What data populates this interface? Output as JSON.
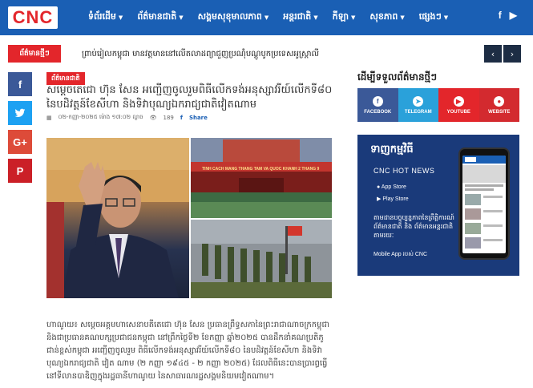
{
  "brand": {
    "logo": "CNC"
  },
  "nav": {
    "items": [
      {
        "label": "ទំព័រដើម"
      },
      {
        "label": "ព័ត៌មានជាតិ"
      },
      {
        "label": "សង្គមសុខុមាលភាព"
      },
      {
        "label": "អន្តរជាតិ"
      },
      {
        "label": "កីឡា"
      },
      {
        "label": "សុខភាព"
      },
      {
        "label": "ផ្សេងៗ"
      }
    ]
  },
  "breaking": {
    "label": "ព័ត៌មានថ្មីៗ",
    "text": "ព្រាប់រៀលកម្ពុជា មានវត្តមាននៅលើតលាដព្យាជួញប្រណ៉ុំបណ្តូបូកប្រទេសអូស្ត្រាលី"
  },
  "article": {
    "category": "ព័ត៌មានជាតិ",
    "title": "សម្តេចតេជោ ហ៊ុន សែន អញ្ជើញចូលរួមពិធីលើកទង់អនុស្សាវរីយ៍លើកទី៨០ នៃបដិវត្តន៍ខែសីហា និងទិវាបុណ្យឯករាជ្យជាតិវៀតណាម",
    "date": "០២-កញ្ញា-២០២៥ ម៉ោង ១៧:០២ ល្ងាច",
    "views": "189",
    "share_label": "Share",
    "banner_text": "TINH CACH MANG THANG TAM VA QUOC KHANH 2 THANG 9",
    "body": "ហាណូយ៖ សម្តេចអគ្គមហាសេនាបតីតេជោ ហ៊ុន សែន ប្រធានព្រឹទ្ធសភានៃព្រះរាជាណាចក្រកម្ពុជា និងជាប្រធានគណបក្សប្រជាជនកម្ពុជា នៅព្រឹកថ្ងៃទី២ ខែកញ្ញា ឆ្នាំ២០២៥ បានដឹកនាំគណប្រតិភូជាន់ខ្ពស់កម្ពុជា អញ្ជើញចូលរួម ពិធីលើកទង់អនុស្សាវរីយ៍លើកទី៨០ នៃបដិវត្តន៍ខែសីហា និងទិវាបុណ្យឯករាជ្យជាតិ វៀត ណាម (២ កញ្ញា ១៩៤៥ - ២ កញ្ញា ២០២៥) ដែលពិធីនេះបានប្រារព្ធធ្វើនៅទីលានបាឌិញក្នុងរដ្ឋធានីហាណូយ នៃសាធារណរដ្ឋសង្គមនិយមវៀតណាម។"
  },
  "sidebar": {
    "follow_title": "ដើម្បីទទួលព័ត៌មានថ្មីៗ",
    "buttons": [
      {
        "label": "FACEBOOK",
        "icon": "f",
        "color": "#3b5998"
      },
      {
        "label": "TELEGRAM",
        "icon": "➤",
        "color": "#2aa1da"
      },
      {
        "label": "YOUTUBE",
        "icon": "▶",
        "color": "#e3262b"
      },
      {
        "label": "WEBSITE",
        "icon": "●",
        "color": "#e3262b"
      }
    ],
    "ad": {
      "title": "ទាញកម្មវិធី",
      "subtitle": "CNC HOT NEWS",
      "app_store": "App Store",
      "play_store": "Play Store",
      "desc": "តាមដានបច្ចុប្បន្នភាពនៃព្រឹត្តិការណ៍ព័ត៌មានជាតិ និង ព័ត៌មានអន្តរជាតិតាមរយៈ",
      "foot": "Mobile App របស់ CNC"
    }
  },
  "share": {
    "items": [
      {
        "icon": "f",
        "color": "#3b5998"
      },
      {
        "icon": "t",
        "color": "#1da1f2"
      },
      {
        "icon": "G+",
        "color": "#dd4b39"
      },
      {
        "icon": "P",
        "color": "#cb2027"
      }
    ]
  },
  "colors": {
    "primary": "#1a5fb4",
    "accent": "#e3262b"
  }
}
